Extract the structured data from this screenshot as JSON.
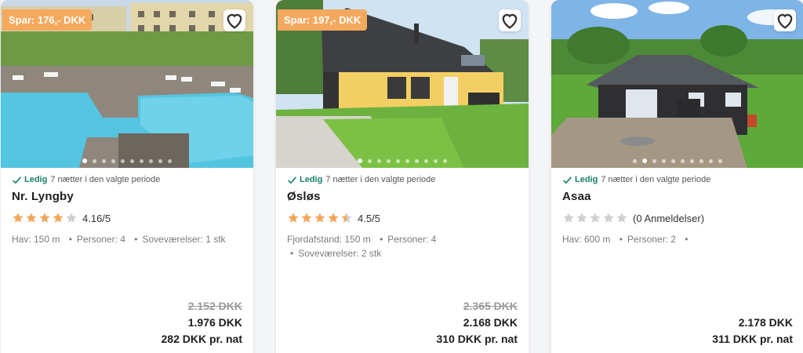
{
  "listings": [
    {
      "badge": "Spar: 176,- DKK",
      "available_label": "Ledig",
      "period": "7 nætter i den valgte periode",
      "title": "Nr. Lyngby",
      "stars": 4,
      "rating_text": "4.16/5",
      "meta_line1": [
        "Hav: 150 m",
        "Personer: 4",
        "Soveværelser: 1 stk"
      ],
      "meta_line2": "",
      "old_price": "2.152 DKK",
      "price": "1.976 DKK",
      "per_night": "282 DKK pr. nat",
      "image_dots": 10,
      "active_dot": 0,
      "photo_icon": "pool-photo"
    },
    {
      "badge": "Spar: 197,- DKK",
      "available_label": "Ledig",
      "period": "7 nætter i den valgte periode",
      "title": "Øsløs",
      "stars": 4.5,
      "rating_text": "4.5/5",
      "meta_line1": [
        "Fjordafstand: 150 m",
        "Personer: 4"
      ],
      "meta_line2": "Soveværelser: 2 stk",
      "old_price": "2.365 DKK",
      "price": "2.168 DKK",
      "per_night": "310 DKK pr. nat",
      "image_dots": 10,
      "active_dot": 0,
      "photo_icon": "yellow-house-photo"
    },
    {
      "badge": "",
      "available_label": "Ledig",
      "period": "7 nætter i den valgte periode",
      "title": "Asaa",
      "stars": 0,
      "rating_text": "(0 Anmeldelser)",
      "meta_line1": [
        "Hav: 600 m",
        "Personer: 2",
        ""
      ],
      "meta_line2": "",
      "old_price": "",
      "price": "2.178 DKK",
      "per_night": "311 DKK pr. nat",
      "image_dots": 10,
      "active_dot": 1,
      "photo_icon": "black-cabin-photo"
    }
  ],
  "colors": {
    "badge": "#f5a95f",
    "star_filled": "#f2a65a",
    "star_empty": "#cfcfcf",
    "available": "#1a7f6a"
  }
}
